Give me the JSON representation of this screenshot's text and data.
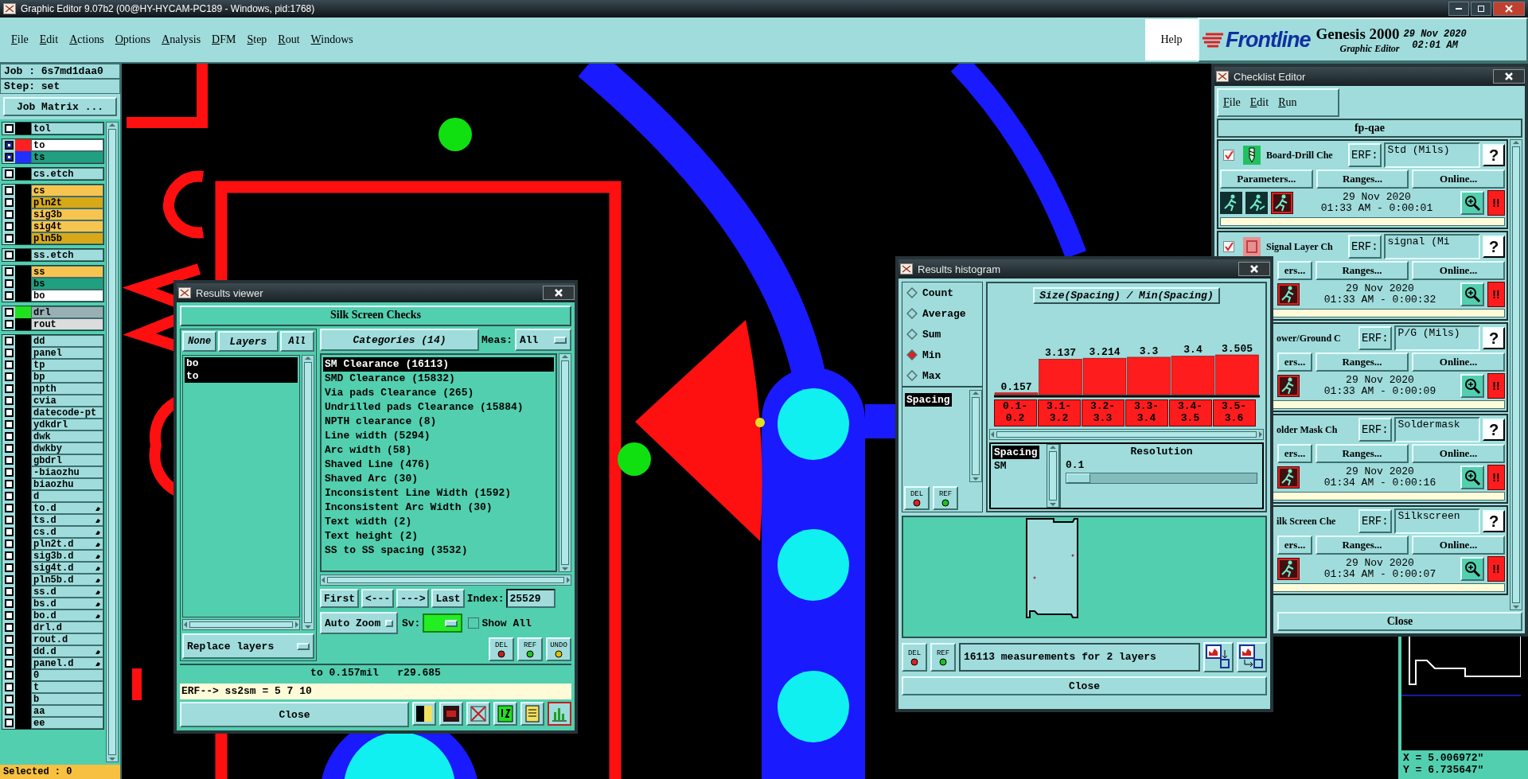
{
  "main_window": {
    "title": "Graphic Editor 9.07b2 (00@HY-HYCAM-PC189 - Windows, pid:1768)"
  },
  "menu": [
    "File",
    "Edit",
    "Actions",
    "Options",
    "Analysis",
    "DFM",
    "Step",
    "Rout",
    "Windows"
  ],
  "help_menu": "Help",
  "brand": {
    "logo": "Frontline",
    "product": "Genesis 2000",
    "subtitle": "Graphic Editor",
    "date": "29 Nov 2020",
    "time": "02:01 AM"
  },
  "job_panel": {
    "job": "Job : 6s7md1daa0",
    "step": "Step: set",
    "job_matrix_button": "Job Matrix ...",
    "selected_count": "Selected : 0",
    "layer_groups": [
      {
        "layers": [
          {
            "name": "tol",
            "color": "#a0dcdc",
            "swatch": {
              "color": "#000000"
            },
            "affected": false,
            "marker": false
          }
        ]
      },
      {
        "layers": [
          {
            "name": "to",
            "color": "#ffffff",
            "swatch": {
              "color": "#ff2020"
            },
            "affected": true,
            "marker": false
          },
          {
            "name": "ts",
            "color": "#20a080",
            "swatch": {
              "color": "#2030ff"
            },
            "affected": true,
            "marker": false
          }
        ]
      },
      {
        "layers": [
          {
            "name": "cs.etch",
            "color": "#a0dcdc",
            "swatch": {
              "color": "#000000"
            },
            "affected": false,
            "marker": false
          }
        ]
      },
      {
        "layers": [
          {
            "name": "cs",
            "color": "#f8c450",
            "swatch": {
              "color": "#000000"
            },
            "affected": false,
            "marker": false
          },
          {
            "name": "pln2t",
            "color": "#d8a818",
            "swatch": {
              "color": "#000000"
            },
            "affected": false,
            "marker": false
          },
          {
            "name": "sig3b",
            "color": "#f8c450",
            "swatch": {
              "color": "#000000"
            },
            "affected": false,
            "marker": false
          },
          {
            "name": "sig4t",
            "color": "#f8c450",
            "swatch": {
              "color": "#000000"
            },
            "affected": false,
            "marker": false
          },
          {
            "name": "pln5b",
            "color": "#d8a818",
            "swatch": {
              "color": "#000000"
            },
            "affected": false,
            "marker": false
          }
        ]
      },
      {
        "layers": [
          {
            "name": "ss.etch",
            "color": "#a0dcdc",
            "swatch": {
              "color": "#000000"
            },
            "affected": false,
            "marker": false
          }
        ]
      },
      {
        "layers": [
          {
            "name": "ss",
            "color": "#f8c450",
            "swatch": {
              "color": "#000000"
            },
            "affected": false,
            "marker": false
          },
          {
            "name": "bs",
            "color": "#20a080",
            "swatch": {
              "color": "#000000"
            },
            "affected": false,
            "marker": false
          },
          {
            "name": "bo",
            "color": "#ffffff",
            "swatch": {
              "color": "#000000"
            },
            "affected": false,
            "marker": false
          }
        ]
      },
      {
        "layers": [
          {
            "name": "drl",
            "color": "#98b0b4",
            "swatch": {
              "color": "#20e020"
            },
            "affected": false,
            "marker": false
          },
          {
            "name": "rout",
            "color": "#dcdcdc",
            "swatch": {
              "color": "#000000"
            },
            "affected": false,
            "marker": false
          }
        ]
      },
      {
        "layers": [
          {
            "name": "dd",
            "color": "#a0dcdc",
            "swatch": {
              "color": "#000000"
            },
            "affected": false,
            "marker": false
          },
          {
            "name": "panel",
            "color": "#a0dcdc",
            "swatch": {
              "color": "#000000"
            },
            "affected": false,
            "marker": false
          },
          {
            "name": "tp",
            "color": "#a0dcdc",
            "swatch": {
              "color": "#000000"
            },
            "affected": false,
            "marker": false
          },
          {
            "name": "bp",
            "color": "#a0dcdc",
            "swatch": {
              "color": "#000000"
            },
            "affected": false,
            "marker": false
          },
          {
            "name": "npth",
            "color": "#a0dcdc",
            "swatch": {
              "color": "#000000"
            },
            "affected": false,
            "marker": false
          },
          {
            "name": "cvia",
            "color": "#a0dcdc",
            "swatch": {
              "color": "#000000"
            },
            "affected": false,
            "marker": false
          },
          {
            "name": "datecode-pt",
            "color": "#a0dcdc",
            "swatch": {
              "color": "#000000"
            },
            "affected": false,
            "marker": false
          },
          {
            "name": "ydkdrl",
            "color": "#a0dcdc",
            "swatch": {
              "color": "#000000"
            },
            "affected": false,
            "marker": false
          },
          {
            "name": "dwk",
            "color": "#a0dcdc",
            "swatch": {
              "color": "#000000"
            },
            "affected": false,
            "marker": false
          },
          {
            "name": "dwkby",
            "color": "#a0dcdc",
            "swatch": {
              "color": "#000000"
            },
            "affected": false,
            "marker": false
          },
          {
            "name": "gbdrl",
            "color": "#a0dcdc",
            "swatch": {
              "color": "#000000"
            },
            "affected": false,
            "marker": false
          },
          {
            "name": "-biaozhu",
            "color": "#a0dcdc",
            "swatch": {
              "color": "#000000"
            },
            "affected": false,
            "marker": false
          },
          {
            "name": "biaozhu",
            "color": "#a0dcdc",
            "swatch": {
              "color": "#000000"
            },
            "affected": false,
            "marker": false
          },
          {
            "name": "d",
            "color": "#a0dcdc",
            "swatch": {
              "color": "#000000"
            },
            "affected": false,
            "marker": false
          },
          {
            "name": "to.d",
            "color": "#a0dcdc",
            "swatch": {
              "color": "#000000"
            },
            "affected": false,
            "marker": true
          },
          {
            "name": "ts.d",
            "color": "#a0dcdc",
            "swatch": {
              "color": "#000000"
            },
            "affected": false,
            "marker": true
          },
          {
            "name": "cs.d",
            "color": "#a0dcdc",
            "swatch": {
              "color": "#000000"
            },
            "affected": false,
            "marker": true
          },
          {
            "name": "pln2t.d",
            "color": "#a0dcdc",
            "swatch": {
              "color": "#000000"
            },
            "affected": false,
            "marker": true
          },
          {
            "name": "sig3b.d",
            "color": "#a0dcdc",
            "swatch": {
              "color": "#000000"
            },
            "affected": false,
            "marker": true
          },
          {
            "name": "sig4t.d",
            "color": "#a0dcdc",
            "swatch": {
              "color": "#000000"
            },
            "affected": false,
            "marker": true
          },
          {
            "name": "pln5b.d",
            "color": "#a0dcdc",
            "swatch": {
              "color": "#000000"
            },
            "affected": false,
            "marker": true
          },
          {
            "name": "ss.d",
            "color": "#a0dcdc",
            "swatch": {
              "color": "#000000"
            },
            "affected": false,
            "marker": true
          },
          {
            "name": "bs.d",
            "color": "#a0dcdc",
            "swatch": {
              "color": "#000000"
            },
            "affected": false,
            "marker": true
          },
          {
            "name": "bo.d",
            "color": "#a0dcdc",
            "swatch": {
              "color": "#000000"
            },
            "affected": false,
            "marker": true
          },
          {
            "name": "drl.d",
            "color": "#a0dcdc",
            "swatch": {
              "color": "#000000"
            },
            "affected": false,
            "marker": false
          },
          {
            "name": "rout.d",
            "color": "#a0dcdc",
            "swatch": {
              "color": "#000000"
            },
            "affected": false,
            "marker": false
          },
          {
            "name": "dd.d",
            "color": "#a0dcdc",
            "swatch": {
              "color": "#000000"
            },
            "affected": false,
            "marker": true
          },
          {
            "name": "panel.d",
            "color": "#a0dcdc",
            "swatch": {
              "color": "#000000"
            },
            "affected": false,
            "marker": true
          },
          {
            "name": "0",
            "color": "#a0dcdc",
            "swatch": {
              "color": "#000000"
            },
            "affected": false,
            "marker": false
          },
          {
            "name": "t",
            "color": "#a0dcdc",
            "swatch": {
              "color": "#000000"
            },
            "affected": false,
            "marker": false
          },
          {
            "name": "b",
            "color": "#a0dcdc",
            "swatch": {
              "color": "#000000"
            },
            "affected": false,
            "marker": false
          },
          {
            "name": "aa",
            "color": "#a0dcdc",
            "swatch": {
              "color": "#000000"
            },
            "affected": false,
            "marker": false
          },
          {
            "name": "ee",
            "color": "#a0dcdc",
            "swatch": {
              "color": "#000000"
            },
            "affected": false,
            "marker": false
          }
        ]
      }
    ]
  },
  "results_viewer": {
    "title": "Results viewer",
    "header": "Silk Screen Checks",
    "layer_buttons": [
      "None",
      "Layers",
      "All"
    ],
    "layers": [
      {
        "name": "bo",
        "selected": true
      },
      {
        "name": "to",
        "selected": true
      }
    ],
    "categories_button": "Categories (14)",
    "meas_label": "Meas:",
    "meas_value": "All",
    "categories": [
      {
        "label": "SM Clearance (16113)",
        "selected": true
      },
      {
        "label": "SMD Clearance (15832)",
        "selected": false
      },
      {
        "label": "Via pads Clearance (265)",
        "selected": false
      },
      {
        "label": "Undrilled pads Clearance (15884)",
        "selected": false
      },
      {
        "label": "NPTH clearance (8)",
        "selected": false
      },
      {
        "label": "Line width (5294)",
        "selected": false
      },
      {
        "label": "Arc width (58)",
        "selected": false
      },
      {
        "label": "Shaved Line (476)",
        "selected": false
      },
      {
        "label": "Shaved Arc (30)",
        "selected": false
      },
      {
        "label": "Inconsistent Line Width (1592)",
        "selected": false
      },
      {
        "label": "Inconsistent Arc Width (30)",
        "selected": false
      },
      {
        "label": "Text width (2)",
        "selected": false
      },
      {
        "label": "Text height (2)",
        "selected": false
      },
      {
        "label": "SS to SS spacing (3532)",
        "selected": false
      }
    ],
    "nav_buttons": [
      "First",
      "<---",
      "--->",
      "Last"
    ],
    "index_label": "Index:",
    "index_value": "25529",
    "zoom_mode": "Auto Zoom",
    "sv_label": "Sv:",
    "sv_dropdown": {
      "color": "#22ee22"
    },
    "show_all": {
      "label": "Show All",
      "checked": false
    },
    "replace_mode": "Replace layers",
    "action_buttons": [
      "DEL",
      "REF",
      "UNDO"
    ],
    "status": "to 0.157mil   r29.685",
    "erf_line": "ERF--> ss2sm = 5 7 10",
    "close": "Close"
  },
  "results_histogram": {
    "title": "Results histogram",
    "modes": [
      {
        "label": "Count",
        "selected": false
      },
      {
        "label": "Average",
        "selected": false
      },
      {
        "label": "Sum",
        "selected": false
      },
      {
        "label": "Min",
        "selected": true
      },
      {
        "label": "Max",
        "selected": false
      }
    ],
    "measures": [
      {
        "label": "Spacing",
        "selected": true
      }
    ],
    "side_buttons": [
      "DEL",
      "REF"
    ],
    "chart_data": {
      "type": "bar",
      "title": "Size(Spacing) / Min(Spacing)",
      "categories": [
        "0.1-0.2",
        "3.1-3.2",
        "3.2-3.3",
        "3.3-3.4",
        "3.4-3.5",
        "3.5-3.6"
      ],
      "values": [
        0.157,
        3.137,
        3.214,
        3.3,
        3.4,
        3.505
      ],
      "data_labels": true
    },
    "sub_list": [
      {
        "label": "Spacing",
        "selected": true
      },
      {
        "label": "SM",
        "selected": false
      }
    ],
    "resolution": {
      "label": "Resolution",
      "value": "0.1",
      "level": 0.0
    },
    "footer_buttons": [
      "DEL",
      "REF"
    ],
    "summary": "16113 measurements for 2 layers",
    "close": "Close"
  },
  "checklist_editor": {
    "title": "Checklist Editor",
    "menu": [
      "File",
      "Edit",
      "Run"
    ],
    "checklist": "fp-qae",
    "rows": [
      {
        "checked": true,
        "name": "Board-Drill Che",
        "erf_label": "ERF:",
        "erf_value": "Std (Mils)",
        "help": "?",
        "covered": false,
        "parameters": "Parameters...",
        "ranges": "Ranges...",
        "online": "Online...",
        "date": "29 Nov 2020",
        "time": "01:33 AM - 0:00:01",
        "alert": "!!"
      },
      {
        "checked": true,
        "name": "Signal Layer Ch",
        "erf_label": "ERF:",
        "erf_value": "signal (Mi",
        "help": "?",
        "covered": true,
        "parameters": "ers...",
        "ranges": "Ranges...",
        "online": "Online...",
        "date": "29 Nov 2020",
        "time": "01:33 AM - 0:00:32",
        "alert": "!!"
      },
      {
        "name": "ower/Ground C",
        "erf_label": "ERF:",
        "erf_value": "P/G (Mils)",
        "help": "?",
        "covered": true,
        "parameters": "ers...",
        "ranges": "Ranges...",
        "online": "Online...",
        "date": "29 Nov 2020",
        "time": "01:33 AM - 0:00:09",
        "alert": "!!"
      },
      {
        "name": "older Mask Ch",
        "erf_label": "ERF:",
        "erf_value": "Soldermask",
        "help": "?",
        "covered": true,
        "parameters": "ers...",
        "ranges": "Ranges...",
        "online": "Online...",
        "date": "29 Nov 2020",
        "time": "01:34 AM - 0:00:16",
        "alert": "!!"
      },
      {
        "name": "ilk Screen Che",
        "erf_label": "ERF:",
        "erf_value": "Silkscreen",
        "help": "?",
        "covered": true,
        "parameters": "ers...",
        "ranges": "Ranges...",
        "online": "Online...",
        "date": "29 Nov 2020",
        "time": "01:34 AM - 0:00:07",
        "alert": "!!"
      }
    ],
    "close": "Close"
  },
  "coordinates": [
    "X = 5.006972\"",
    "Y = 6.735647\""
  ]
}
